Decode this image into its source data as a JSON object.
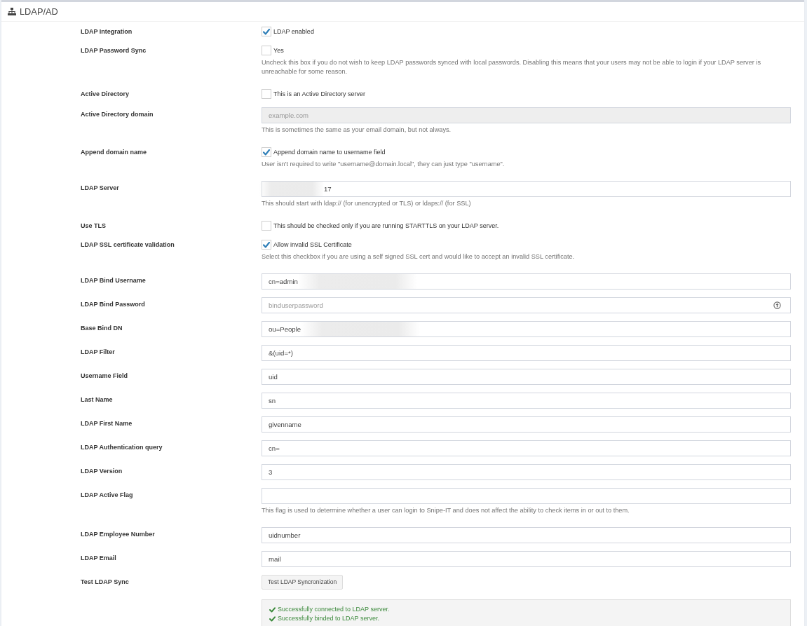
{
  "header": {
    "title": "LDAP/AD"
  },
  "rows": [
    {
      "label": "LDAP Integration",
      "kind": "checkbox",
      "checked": true,
      "text": "LDAP enabled"
    },
    {
      "label": "LDAP Password Sync",
      "kind": "checkbox",
      "checked": false,
      "text": "Yes",
      "help": "Uncheck this box if you do not wish to keep LDAP passwords synced with local passwords. Disabling this means that your users may not be able to login if your LDAP server is unreachable for some reason."
    },
    {
      "label": "Active Directory",
      "kind": "checkbox",
      "checked": false,
      "text": "This is an Active Directory server"
    },
    {
      "label": "Active Directory domain",
      "kind": "input",
      "disabled": true,
      "placeholder": "example.com",
      "help": "This is sometimes the same as your email domain, but not always."
    },
    {
      "label": "Append domain name",
      "kind": "checkbox",
      "checked": true,
      "text": "Append domain name to username field",
      "help": "User isn't required to write \"username@domain.local\", they can just type \"username\"."
    },
    {
      "label": "LDAP Server",
      "kind": "blurred",
      "disabled": false,
      "value": "17",
      "blur_first": true,
      "help": "This should start with ldap:// (for unencrypted or TLS) or ldaps:// (for SSL)"
    },
    {
      "label": "Use TLS",
      "kind": "checkbox",
      "checked": false,
      "text": "This should be checked only if you are running STARTTLS on your LDAP server."
    },
    {
      "label": "LDAP SSL certificate validation",
      "kind": "checkbox",
      "checked": true,
      "text": "Allow invalid SSL Certificate",
      "help": "Select this checkbox if you are using a self signed SSL cert and would like to accept an invalid SSL certificate."
    },
    {
      "label": "LDAP Bind Username",
      "kind": "blurred",
      "disabled": false,
      "value": "cn=admin",
      "blur_first": false
    },
    {
      "label": "LDAP Bind Password",
      "kind": "password",
      "disabled": false,
      "placeholder": "binduserpassword"
    },
    {
      "label": "Base Bind DN",
      "kind": "blurred",
      "disabled": false,
      "value": "ou=People",
      "blur_first": false
    },
    {
      "label": "LDAP Filter",
      "kind": "input",
      "disabled": false,
      "value": "&(uid=*)"
    },
    {
      "label": "Username Field",
      "kind": "input",
      "disabled": false,
      "value": "uid"
    },
    {
      "label": "Last Name",
      "kind": "input",
      "disabled": false,
      "value": "sn"
    },
    {
      "label": "LDAP First Name",
      "kind": "input",
      "disabled": false,
      "value": "givenname"
    },
    {
      "label": "LDAP Authentication query",
      "kind": "input",
      "disabled": false,
      "value": "cn="
    },
    {
      "label": "LDAP Version",
      "kind": "input",
      "disabled": false,
      "value": "3"
    },
    {
      "label": "LDAP Active Flag",
      "kind": "input",
      "disabled": false,
      "help": "This flag is used to determine whether a user can login to Snipe-IT and does not affect the ability to check items in or out to them."
    },
    {
      "label": "LDAP Employee Number",
      "kind": "input",
      "disabled": false,
      "value": "uidnumber"
    },
    {
      "label": "LDAP Email",
      "kind": "input",
      "disabled": false,
      "value": "mail"
    },
    {
      "label": "Test LDAP Sync",
      "kind": "button",
      "button": "Test LDAP Syncronization",
      "results": [
        "Successfully connected to LDAP server.",
        "Successfully binded to LDAP server."
      ]
    }
  ]
}
